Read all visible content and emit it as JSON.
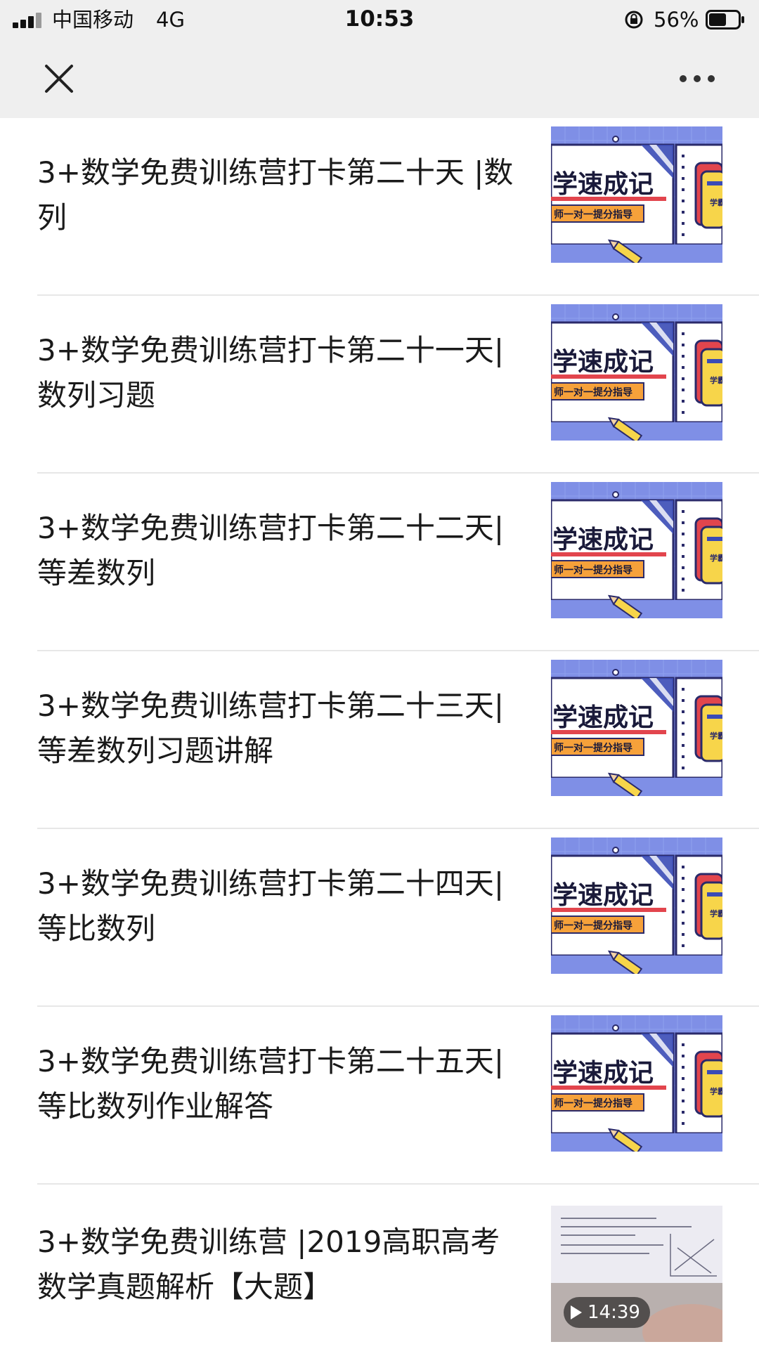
{
  "status_bar": {
    "carrier": "中国移动",
    "network": "4G",
    "time": "10:53",
    "battery": "56%"
  },
  "nav": {
    "close_icon": "close-icon",
    "more_icon": "more-icon"
  },
  "thumbnail_text": {
    "main": "学速成记",
    "sub": "师一对一提分指导",
    "book": "学霸"
  },
  "articles": [
    {
      "title": "3+数学免费训练营打卡第二十天 |数列"
    },
    {
      "title": "3+数学免费训练营打卡第二十一天|数列习题"
    },
    {
      "title": "3+数学免费训练营打卡第二十二天|等差数列"
    },
    {
      "title": "3+数学免费训练营打卡第二十三天|等差数列习题讲解"
    },
    {
      "title": "3+数学免费训练营打卡第二十四天|等比数列"
    },
    {
      "title": "3+数学免费训练营打卡第二十五天|等比数列作业解答"
    },
    {
      "title": "3+数学免费训练营 |2019高职高考数学真题解析【大题】",
      "duration": "14:39"
    }
  ],
  "colors": {
    "thumb_blue": "#7f8fe6",
    "thumb_yellow": "#f7d54a",
    "thumb_orange": "#f6a13a",
    "thumb_red": "#e2454d"
  }
}
